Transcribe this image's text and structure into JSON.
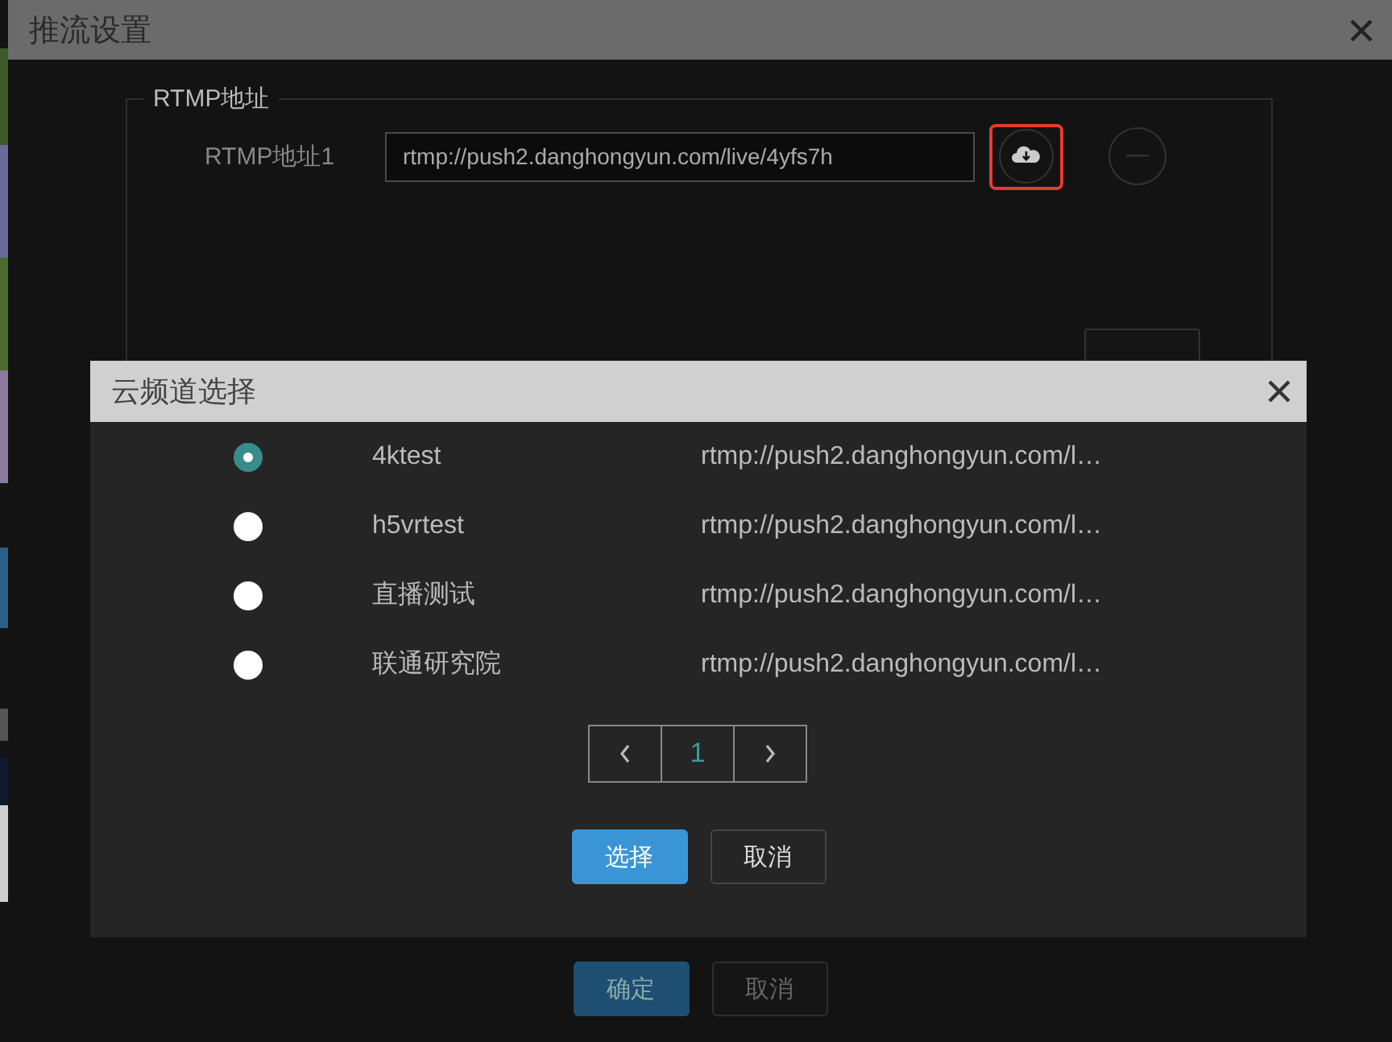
{
  "dialog": {
    "title": "推流设置",
    "rtmp_group": {
      "legend": "RTMP地址",
      "rows": [
        {
          "label": "RTMP地址1",
          "value": "rtmp://push2.danghongyun.com/live/4yfs7h",
          "cloud_highlighted": true
        }
      ]
    },
    "footer_buttons": [
      {
        "label": "确定",
        "kind": "primary"
      },
      {
        "label": "取消",
        "kind": "default"
      }
    ]
  },
  "channel_picker": {
    "title": "云频道选择",
    "channels": [
      {
        "name": "4ktest",
        "url": "rtmp://push2.danghongyun.com/l…",
        "selected": true
      },
      {
        "name": "h5vrtest",
        "url": "rtmp://push2.danghongyun.com/l…",
        "selected": false
      },
      {
        "name": "直播测试",
        "url": "rtmp://push2.danghongyun.com/l…",
        "selected": false
      },
      {
        "name": "联通研究院",
        "url": "rtmp://push2.danghongyun.com/l…",
        "selected": false
      }
    ],
    "pagination": {
      "pages": [
        {
          "label": "1",
          "selected": true
        }
      ]
    },
    "buttons": [
      {
        "label": "选择",
        "kind": "primary"
      },
      {
        "label": "取消",
        "kind": "default"
      }
    ]
  }
}
